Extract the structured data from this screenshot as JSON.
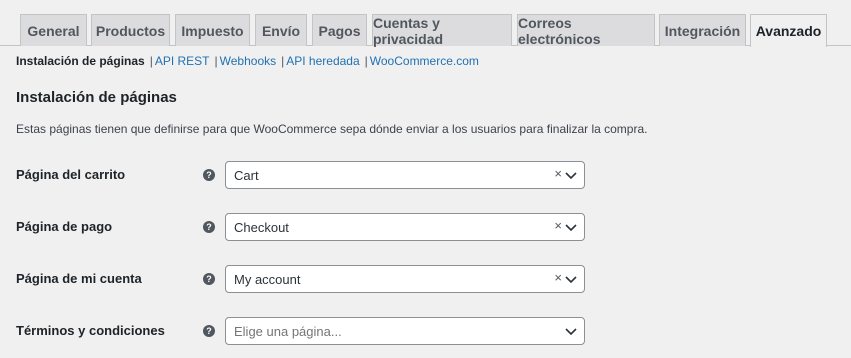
{
  "tabs": [
    {
      "label": "General"
    },
    {
      "label": "Productos"
    },
    {
      "label": "Impuesto"
    },
    {
      "label": "Envío"
    },
    {
      "label": "Pagos"
    },
    {
      "label": "Cuentas y privacidad"
    },
    {
      "label": "Correos electrónicos"
    },
    {
      "label": "Integración"
    },
    {
      "label": "Avanzado"
    }
  ],
  "active_tab": "Avanzado",
  "subnav": {
    "current": "Instalación de páginas",
    "separator": "|",
    "links": [
      "API REST",
      "Webhooks",
      "API heredada",
      "WooCommerce.com"
    ]
  },
  "section": {
    "title": "Instalación de páginas",
    "description": "Estas páginas tienen que definirse para que WooCommerce sepa dónde enviar a los usuarios para finalizar la compra."
  },
  "fields": [
    {
      "label": "Página del carrito",
      "value": "Cart",
      "clearable": true
    },
    {
      "label": "Página de pago",
      "value": "Checkout",
      "clearable": true
    },
    {
      "label": "Página de mi cuenta",
      "value": "My account",
      "clearable": true
    },
    {
      "label": "Términos y condiciones",
      "placeholder": "Elige una página...",
      "clearable": false
    }
  ],
  "icons": {
    "help": "question-circle-icon",
    "clear": "clear-x-icon",
    "dropdown": "chevron-down-icon",
    "clear_glyph": "×",
    "help_glyph": "?"
  },
  "colors": {
    "link": "#2271b1",
    "background": "#f0f0f1",
    "tab_inactive": "#dcdcde"
  }
}
